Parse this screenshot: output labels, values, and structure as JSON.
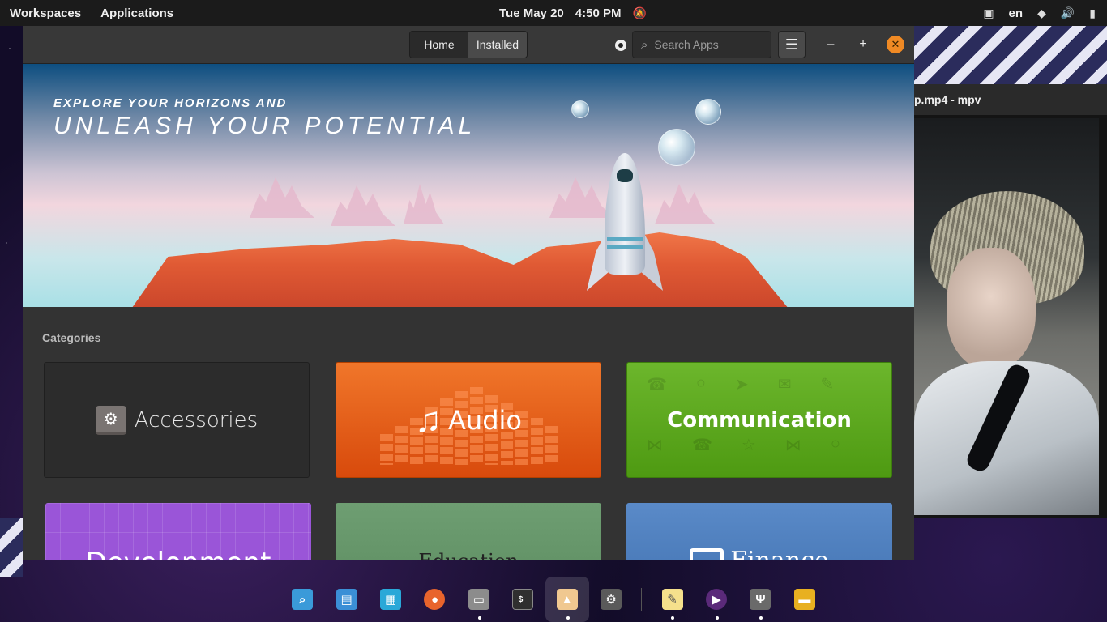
{
  "top_panel": {
    "workspaces": "Workspaces",
    "applications": "Applications",
    "date": "Tue May 20",
    "time": "4:50 PM",
    "language": "en"
  },
  "mpv": {
    "title": "p.mp4 - mpv"
  },
  "app_center": {
    "tabs": [
      {
        "label": "Home",
        "selected": true
      },
      {
        "label": "Installed",
        "selected": false
      }
    ],
    "search": {
      "placeholder": "Search Apps",
      "value": ""
    },
    "banner": {
      "line1": "EXPLORE YOUR HORIZONS AND",
      "line2": "UNLEASH YOUR POTENTIAL"
    },
    "categories_title": "Categories",
    "categories": [
      {
        "label": "Accessories",
        "color": "#2c2c2c"
      },
      {
        "label": "Audio",
        "color": "#e55e1a"
      },
      {
        "label": "Communication",
        "color": "#5ca81e"
      },
      {
        "label": "Development",
        "color": "#9a55d8"
      },
      {
        "label": "Education",
        "color": "#6e9e72"
      },
      {
        "label": "Finance",
        "color": "#4c7dbb"
      }
    ]
  },
  "dock": {
    "items": [
      {
        "name": "search-app",
        "color": "#3a9ad9",
        "running": false
      },
      {
        "name": "multitasking-view",
        "color": "#3b8fd6",
        "running": false
      },
      {
        "name": "applications-grid",
        "color": "#2aa8d8",
        "running": false
      },
      {
        "name": "firefox",
        "color": "#e8642c",
        "running": false
      },
      {
        "name": "files",
        "color": "#8c8c8c",
        "running": true
      },
      {
        "name": "terminal",
        "color": "#2f2f2f",
        "running": false
      },
      {
        "name": "app-center",
        "color": "#f0c890",
        "running": true
      },
      {
        "name": "settings",
        "color": "#5a5a5a",
        "running": false
      },
      {
        "name": "text-editor",
        "color": "#f5e08c",
        "running": true
      },
      {
        "name": "mpv",
        "color": "#5b2a7a",
        "running": true
      },
      {
        "name": "usb-installer",
        "color": "#6a6a6a",
        "running": true
      },
      {
        "name": "document-viewer",
        "color": "#e8b020",
        "running": false
      }
    ]
  }
}
